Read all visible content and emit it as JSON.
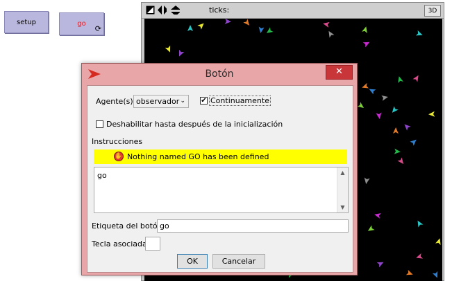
{
  "interface": {
    "setup_button": "setup",
    "go_button": "go",
    "go_forever_glyph": "⟳"
  },
  "view": {
    "ticks_label": "ticks:",
    "three_d_button": "3D",
    "icons": [
      "speed-icon",
      "left-right-icon",
      "up-down-icon"
    ]
  },
  "dialog": {
    "title": "Botón",
    "close_glyph": "✕",
    "agent_label": "Agente(s)",
    "agent_value": "observador",
    "continuous_label": "Continuamente",
    "continuous_checked": true,
    "disable_label": "Deshabilitar hasta después de la inicialización",
    "disable_checked": false,
    "instructions_label": "Instrucciones",
    "error_message": "Nothing named GO has been defined",
    "code": "go",
    "button_label_label": "Etiqueta del botón",
    "button_label_value": "go",
    "hotkey_label": "Tecla asociada",
    "hotkey_value": "",
    "ok": "OK",
    "cancel": "Cancelar"
  },
  "colors": {
    "button_bg": "#bab7df",
    "dialog_frame": "#e8a6a8",
    "close_red": "#c9363a",
    "error_yellow": "#ffff00",
    "world_bg": "#000000"
  }
}
